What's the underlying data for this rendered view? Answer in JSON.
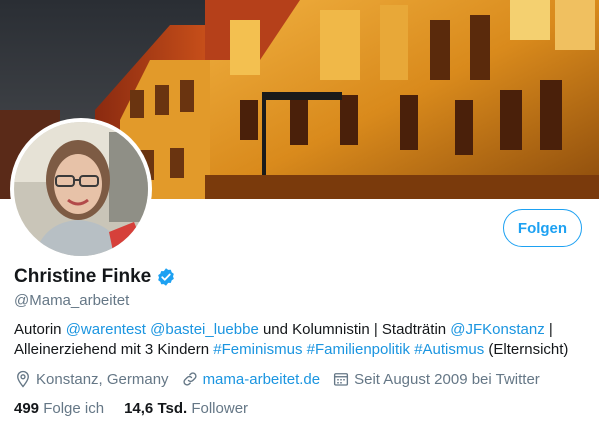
{
  "profile": {
    "name": "Christine Finke",
    "handle": "@Mama_arbeitet",
    "verified": true,
    "follow_button": "Folgen",
    "bio": {
      "w1": "Autorin ",
      "m1": "@warentest",
      "w2": " ",
      "m2": "@bastei_luebbe",
      "w3": " und Kolumnistin | Stadträtin ",
      "m3": "@JFKonstanz",
      "w4": " |",
      "w5": "Alleinerziehend mit 3 Kindern ",
      "h1": "#Feminismus",
      "w6": " ",
      "h2": "#Familienpolitik",
      "w7": " ",
      "h3": "#Autismus",
      "w8": " (Elternsicht)"
    },
    "location": "Konstanz, Germany",
    "website": "mama-arbeitet.de",
    "joined": "Seit August 2009 bei Twitter",
    "following_count": "499",
    "following_label": "Folge ich",
    "followers_count": "14,6 Tsd.",
    "followers_label": "Follower"
  },
  "colors": {
    "accent": "#1da1f2",
    "link": "#1b95e0",
    "muted": "#657786",
    "text": "#14171a"
  },
  "icons": [
    "location-pin-icon",
    "link-icon",
    "calendar-icon",
    "verified-badge-icon"
  ]
}
